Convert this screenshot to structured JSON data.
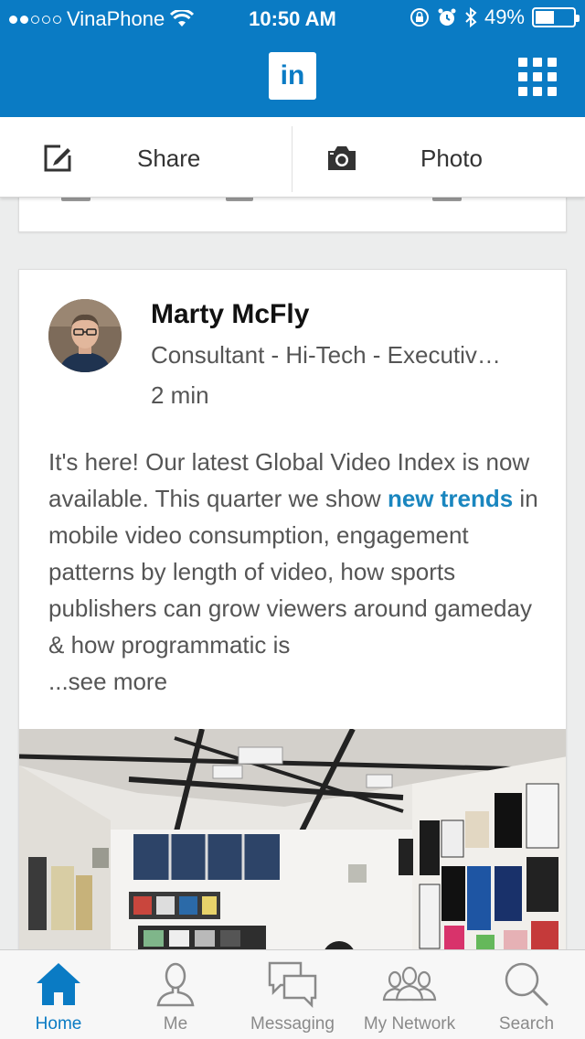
{
  "status_bar": {
    "carrier": "VinaPhone",
    "signal_dots_filled": 2,
    "signal_dots_total": 5,
    "time": "10:50 AM",
    "battery": "49%",
    "battery_level": 0.49
  },
  "header": {
    "logo_text": "in",
    "brand_color": "#0a7bc4"
  },
  "share_bar": {
    "share_label": "Share",
    "photo_label": "Photo"
  },
  "post": {
    "author_name": "Marty McFly",
    "author_title": "Consultant - Hi-Tech - Executiv…",
    "time": "2 min",
    "text_before": "It's here! Our latest Global Video Index is now available. This quarter we show ",
    "link_text": "new trends",
    "text_after": " in mobile video consumption, engagement patterns by length of video, how sports publishers can grow viewers around gameday & how programmatic is",
    "see_more": "...see more"
  },
  "tabs": [
    {
      "label": "Home",
      "icon": "home-icon",
      "active": true
    },
    {
      "label": "Me",
      "icon": "person-icon",
      "active": false
    },
    {
      "label": "Messaging",
      "icon": "messaging-icon",
      "active": false
    },
    {
      "label": "My Network",
      "icon": "network-icon",
      "active": false
    },
    {
      "label": "Search",
      "icon": "search-icon",
      "active": false
    }
  ],
  "colors": {
    "accent": "#0a7bc4",
    "link": "#1a86bf"
  }
}
